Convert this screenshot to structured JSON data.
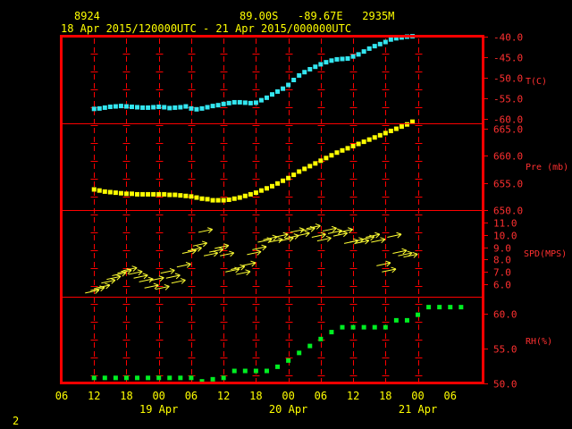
{
  "header": {
    "station_id": "8924",
    "location": "89.00S   -89.67E   2935M",
    "time_range": "18 Apr 2015/120000UTC - 21 Apr 2015/000000UTC"
  },
  "footer_number": "2",
  "colors": {
    "background": "#000000",
    "frame": "#ff0000",
    "text": "#ffff00",
    "label": "#ff3030",
    "temperature": "#33e6f0",
    "pressure": "#ffff00",
    "wind": "#ffff33",
    "humidity": "#00ee22"
  },
  "chart_data": {
    "type": "scatter",
    "x_axis": {
      "unit": "hours from 18 Apr 06 UTC",
      "range": [
        0,
        78
      ],
      "ticks": [
        {
          "x": 0,
          "label": "06"
        },
        {
          "x": 6,
          "label": "12"
        },
        {
          "x": 12,
          "label": "18"
        },
        {
          "x": 18,
          "label": "00"
        },
        {
          "x": 24,
          "label": "06"
        },
        {
          "x": 30,
          "label": "12"
        },
        {
          "x": 36,
          "label": "18"
        },
        {
          "x": 42,
          "label": "00"
        },
        {
          "x": 48,
          "label": "06"
        },
        {
          "x": 54,
          "label": "12"
        },
        {
          "x": 60,
          "label": "18"
        },
        {
          "x": 66,
          "label": "00"
        },
        {
          "x": 72,
          "label": "06"
        }
      ],
      "date_labels": [
        {
          "x": 18,
          "label": "19 Apr"
        },
        {
          "x": 42,
          "label": "20 Apr"
        },
        {
          "x": 66,
          "label": "21 Apr"
        }
      ]
    },
    "panels": [
      {
        "name": "T(C)",
        "label": "T(C)",
        "ylim": [
          -61,
          -40
        ],
        "ticks": [
          -40,
          -45,
          -50,
          -55,
          -60
        ],
        "tick_labels": [
          "-40.0",
          "-45.0",
          "-50.0",
          "-55.0",
          "-60.0"
        ],
        "points": [
          [
            6,
            -57.5
          ],
          [
            7,
            -57.4
          ],
          [
            8,
            -57.2
          ],
          [
            9,
            -57.0
          ],
          [
            10,
            -56.9
          ],
          [
            11,
            -56.8
          ],
          [
            12,
            -56.9
          ],
          [
            13,
            -57.0
          ],
          [
            14,
            -57.1
          ],
          [
            15,
            -57.2
          ],
          [
            16,
            -57.2
          ],
          [
            17,
            -57.1
          ],
          [
            18,
            -57.0
          ],
          [
            19,
            -57.1
          ],
          [
            20,
            -57.3
          ],
          [
            21,
            -57.2
          ],
          [
            22,
            -57.1
          ],
          [
            23,
            -56.9
          ],
          [
            24,
            -57.4
          ],
          [
            25,
            -57.6
          ],
          [
            26,
            -57.4
          ],
          [
            27,
            -57.1
          ],
          [
            28,
            -56.8
          ],
          [
            29,
            -56.6
          ],
          [
            30,
            -56.3
          ],
          [
            31,
            -56.1
          ],
          [
            32,
            -55.9
          ],
          [
            33,
            -55.9
          ],
          [
            34,
            -56.0
          ],
          [
            35,
            -56.1
          ],
          [
            36,
            -56.0
          ],
          [
            37,
            -55.4
          ],
          [
            38,
            -54.8
          ],
          [
            39,
            -54.0
          ],
          [
            40,
            -53.3
          ],
          [
            41,
            -52.6
          ],
          [
            42,
            -51.7
          ],
          [
            43,
            -50.5
          ],
          [
            44,
            -49.4
          ],
          [
            45,
            -48.6
          ],
          [
            46,
            -47.9
          ],
          [
            47,
            -47.3
          ],
          [
            48,
            -46.7
          ],
          [
            49,
            -46.2
          ],
          [
            50,
            -45.8
          ],
          [
            51,
            -45.5
          ],
          [
            52,
            -45.4
          ],
          [
            53,
            -45.3
          ],
          [
            54,
            -44.8
          ],
          [
            55,
            -44.3
          ],
          [
            56,
            -43.6
          ],
          [
            57,
            -42.9
          ],
          [
            58,
            -42.3
          ],
          [
            59,
            -41.8
          ],
          [
            60,
            -41.3
          ],
          [
            61,
            -40.7
          ],
          [
            62,
            -40.4
          ],
          [
            63,
            -40.2
          ],
          [
            64,
            -40.0
          ],
          [
            65,
            -39.9
          ]
        ]
      },
      {
        "name": "Pre (mb)",
        "label": "Pre (mb)",
        "ylim": [
          650,
          666
        ],
        "ticks": [
          650,
          655,
          660,
          665
        ],
        "tick_labels": [
          "650.0",
          "655.0",
          "660.0",
          "665.0"
        ],
        "points": [
          [
            6,
            653.8
          ],
          [
            7,
            653.6
          ],
          [
            8,
            653.4
          ],
          [
            9,
            653.3
          ],
          [
            10,
            653.2
          ],
          [
            11,
            653.1
          ],
          [
            12,
            653.0
          ],
          [
            13,
            653.0
          ],
          [
            14,
            652.9
          ],
          [
            15,
            652.9
          ],
          [
            16,
            652.9
          ],
          [
            17,
            652.9
          ],
          [
            18,
            652.9
          ],
          [
            19,
            652.9
          ],
          [
            20,
            652.8
          ],
          [
            21,
            652.8
          ],
          [
            22,
            652.7
          ],
          [
            23,
            652.6
          ],
          [
            24,
            652.5
          ],
          [
            25,
            652.3
          ],
          [
            26,
            652.1
          ],
          [
            27,
            652.0
          ],
          [
            28,
            651.8
          ],
          [
            29,
            651.8
          ],
          [
            30,
            651.8
          ],
          [
            31,
            651.9
          ],
          [
            32,
            652.1
          ],
          [
            33,
            652.3
          ],
          [
            34,
            652.6
          ],
          [
            35,
            652.9
          ],
          [
            36,
            653.2
          ],
          [
            37,
            653.6
          ],
          [
            38,
            654.0
          ],
          [
            39,
            654.4
          ],
          [
            40,
            654.9
          ],
          [
            41,
            655.4
          ],
          [
            42,
            655.9
          ],
          [
            43,
            656.5
          ],
          [
            44,
            657.1
          ],
          [
            45,
            657.6
          ],
          [
            46,
            658.1
          ],
          [
            47,
            658.6
          ],
          [
            48,
            659.1
          ],
          [
            49,
            659.6
          ],
          [
            50,
            660.1
          ],
          [
            51,
            660.6
          ],
          [
            52,
            661.0
          ],
          [
            53,
            661.4
          ],
          [
            54,
            661.8
          ],
          [
            55,
            662.2
          ],
          [
            56,
            662.6
          ],
          [
            57,
            663.0
          ],
          [
            58,
            663.4
          ],
          [
            59,
            663.8
          ],
          [
            60,
            664.2
          ],
          [
            61,
            664.6
          ],
          [
            62,
            665.0
          ],
          [
            63,
            665.4
          ],
          [
            64,
            665.8
          ],
          [
            65,
            666.3
          ]
        ]
      },
      {
        "name": "SPD(MPS)",
        "label": "SPD(MPS)",
        "ylim": [
          5,
          12
        ],
        "ticks": [
          6,
          7,
          8,
          9,
          10,
          11
        ],
        "tick_labels": [
          "6.0",
          "7.0",
          "8.0",
          "9.0",
          "10.0",
          "11.0"
        ],
        "points": [
          [
            6,
            5.3
          ],
          [
            7,
            5.5
          ],
          [
            8,
            5.7
          ],
          [
            9,
            6.1
          ],
          [
            10,
            6.4
          ],
          [
            11,
            6.7
          ],
          [
            12,
            6.9
          ],
          [
            13,
            7.1
          ],
          [
            14,
            6.8
          ],
          [
            15,
            6.5
          ],
          [
            16,
            6.2
          ],
          [
            17,
            5.7
          ],
          [
            18,
            6.3
          ],
          [
            19,
            5.6
          ],
          [
            20,
            6.9
          ],
          [
            21,
            6.5
          ],
          [
            22,
            6.1
          ],
          [
            23,
            7.4
          ],
          [
            24,
            8.5
          ],
          [
            25,
            8.7
          ],
          [
            26,
            9.1
          ],
          [
            27,
            10.2
          ],
          [
            28,
            8.3
          ],
          [
            29,
            8.6
          ],
          [
            30,
            8.9
          ],
          [
            31,
            8.3
          ],
          [
            32,
            7.0
          ],
          [
            33,
            7.2
          ],
          [
            34,
            6.8
          ],
          [
            35,
            7.5
          ],
          [
            36,
            8.4
          ],
          [
            37,
            8.8
          ],
          [
            38,
            9.4
          ],
          [
            39,
            9.6
          ],
          [
            40,
            9.4
          ],
          [
            41,
            9.8
          ],
          [
            42,
            9.5
          ],
          [
            43,
            9.7
          ],
          [
            44,
            10.2
          ],
          [
            45,
            9.9
          ],
          [
            46,
            10.3
          ],
          [
            47,
            10.5
          ],
          [
            48,
            9.8
          ],
          [
            49,
            9.5
          ],
          [
            50,
            10.3
          ],
          [
            51,
            10.1
          ],
          [
            52,
            9.9
          ],
          [
            53,
            10.2
          ],
          [
            54,
            9.3
          ],
          [
            55,
            9.4
          ],
          [
            56,
            9.3
          ],
          [
            57,
            9.6
          ],
          [
            58,
            9.8
          ],
          [
            59,
            9.4
          ],
          [
            60,
            7.5
          ],
          [
            61,
            7.0
          ],
          [
            62,
            9.8
          ],
          [
            63,
            8.5
          ],
          [
            64,
            8.3
          ],
          [
            65,
            8.2
          ]
        ]
      },
      {
        "name": "RH(%)",
        "label": "RH(%)",
        "ylim": [
          50,
          62.5
        ],
        "ticks": [
          50,
          55,
          60
        ],
        "tick_labels": [
          "50.0",
          "55.0",
          "60.0"
        ],
        "points": [
          [
            6,
            50.8
          ],
          [
            8,
            50.8
          ],
          [
            10,
            50.8
          ],
          [
            12,
            50.8
          ],
          [
            14,
            50.8
          ],
          [
            16,
            50.8
          ],
          [
            18,
            50.8
          ],
          [
            20,
            50.8
          ],
          [
            22,
            50.8
          ],
          [
            24,
            50.8
          ],
          [
            26,
            50.3
          ],
          [
            28,
            50.6
          ],
          [
            30,
            50.8
          ],
          [
            32,
            51.8
          ],
          [
            34,
            51.8
          ],
          [
            36,
            51.8
          ],
          [
            38,
            51.8
          ],
          [
            40,
            52.4
          ],
          [
            42,
            53.3
          ],
          [
            44,
            54.4
          ],
          [
            46,
            55.4
          ],
          [
            48,
            56.4
          ],
          [
            50,
            57.4
          ],
          [
            52,
            58.1
          ],
          [
            54,
            58.1
          ],
          [
            56,
            58.1
          ],
          [
            58,
            58.1
          ],
          [
            60,
            58.1
          ],
          [
            62,
            59.1
          ],
          [
            64,
            59.1
          ],
          [
            66,
            59.9
          ],
          [
            68,
            61.0
          ],
          [
            70,
            61.0
          ],
          [
            72,
            61.0
          ],
          [
            74,
            61.0
          ]
        ]
      }
    ]
  }
}
